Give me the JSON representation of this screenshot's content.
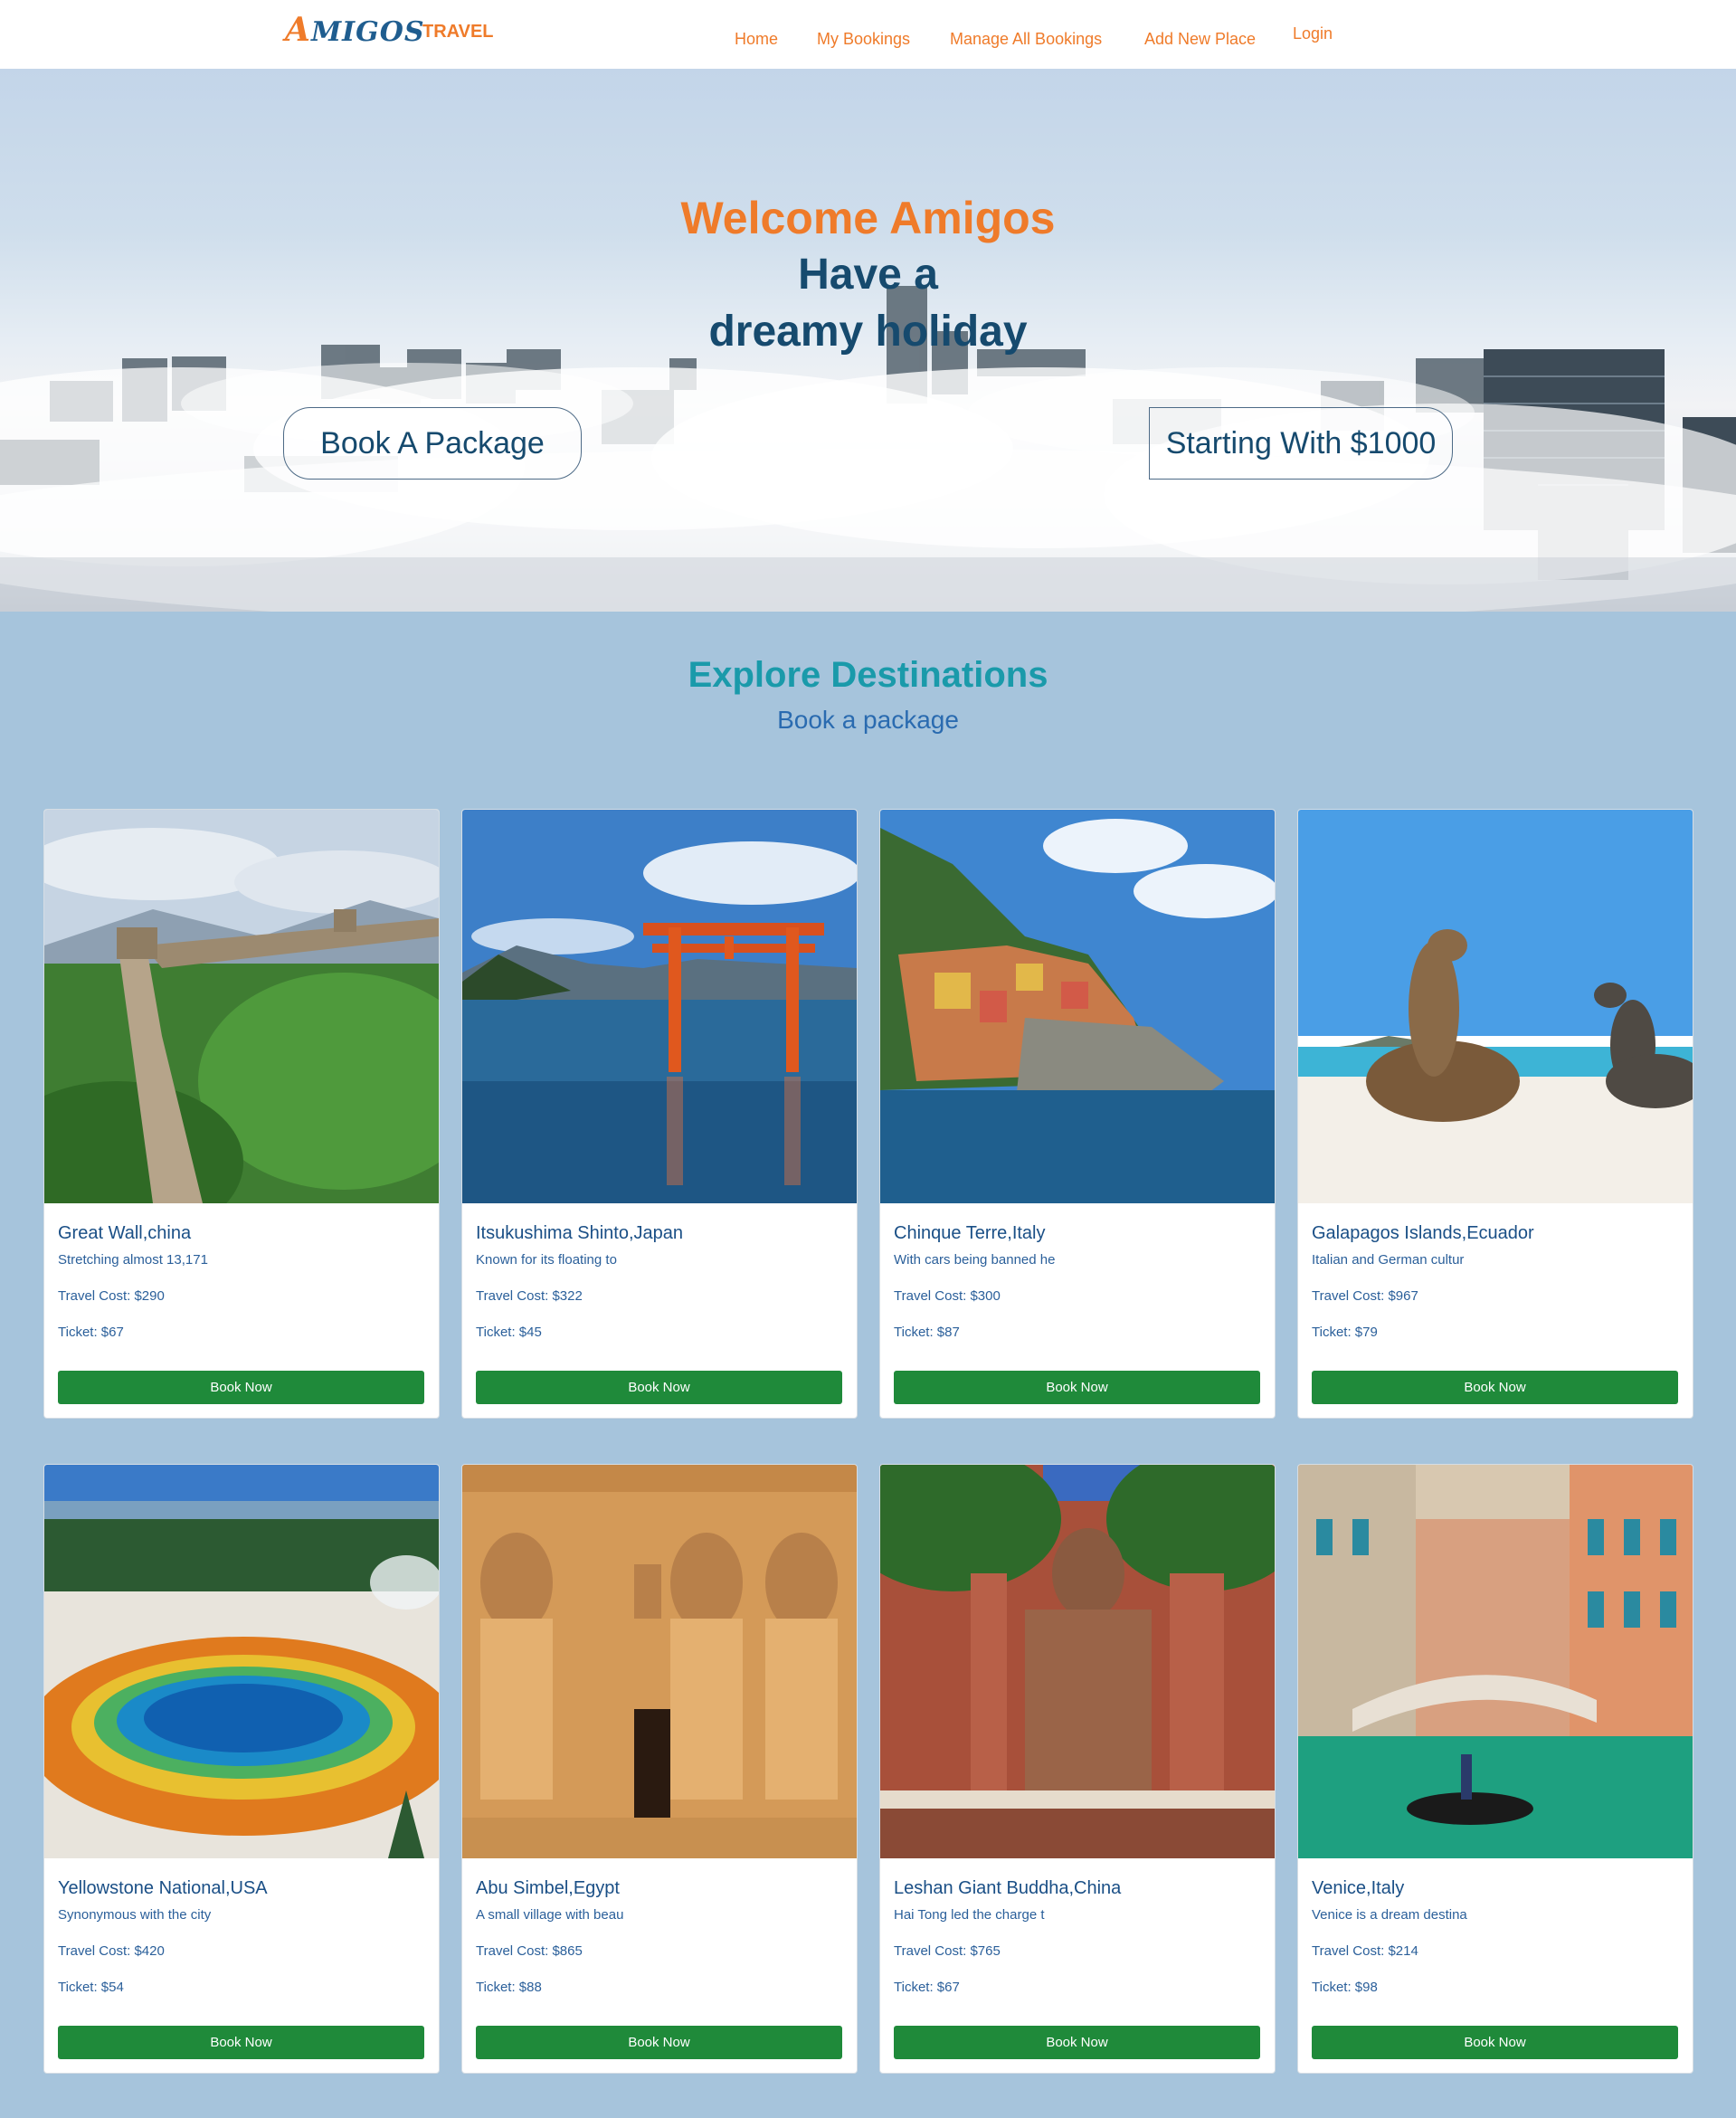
{
  "brand": {
    "mark": "AMIGOS",
    "mark_first": "A",
    "mark_rest": "MIGOS",
    "suffix": "TRAVEL",
    "accent_color": "#ef7b2a",
    "secondary_color": "#1f5d8f"
  },
  "nav": {
    "home": "Home",
    "my_bookings": "My Bookings",
    "manage_all_bookings": "Manage All Bookings",
    "add_new_place": "Add New Place",
    "login": "Login"
  },
  "hero": {
    "welcome": "Welcome Amigos",
    "line_1": "Have a",
    "line_2": "dreamy holiday",
    "book_button": "Book A Package",
    "price_button": "Starting With $1000"
  },
  "explore": {
    "title": "Explore Destinations",
    "subtitle": "Book a package"
  },
  "book_button_label": "Book Now",
  "book_button_color": "#1f8a3a",
  "destinations": [
    {
      "title": "Great Wall,china",
      "desc": "Stretching almost 13,171",
      "cost": "Travel Cost: $290",
      "ticket": "Ticket: $67",
      "image": "great-wall-photo"
    },
    {
      "title": "Itsukushima Shinto,Japan",
      "desc": "Known for its floating to",
      "cost": "Travel Cost: $322",
      "ticket": "Ticket: $45",
      "image": "torii-gate-photo"
    },
    {
      "title": "Chinque Terre,Italy",
      "desc": "With cars being banned he",
      "cost": "Travel Cost: $300",
      "ticket": "Ticket: $87",
      "image": "cinque-terre-photo"
    },
    {
      "title": "Galapagos Islands,Ecuador",
      "desc": "Italian and German cultur",
      "cost": "Travel Cost: $967",
      "ticket": "Ticket: $79",
      "image": "sea-lions-photo"
    },
    {
      "title": "Yellowstone National,USA",
      "desc": "Synonymous with the city",
      "cost": "Travel Cost: $420",
      "ticket": "Ticket: $54",
      "image": "hot-spring-photo"
    },
    {
      "title": "Abu Simbel,Egypt",
      "desc": "A small village with beau",
      "cost": "Travel Cost: $865",
      "ticket": "Ticket: $88",
      "image": "abu-simbel-photo"
    },
    {
      "title": "Leshan Giant Buddha,China",
      "desc": "Hai Tong led the charge t",
      "cost": "Travel Cost: $765",
      "ticket": "Ticket: $67",
      "image": "giant-buddha-photo"
    },
    {
      "title": "Venice,Italy",
      "desc": "Venice is a dream destina",
      "cost": "Travel Cost: $214",
      "ticket": "Ticket: $98",
      "image": "venice-canal-photo"
    }
  ]
}
